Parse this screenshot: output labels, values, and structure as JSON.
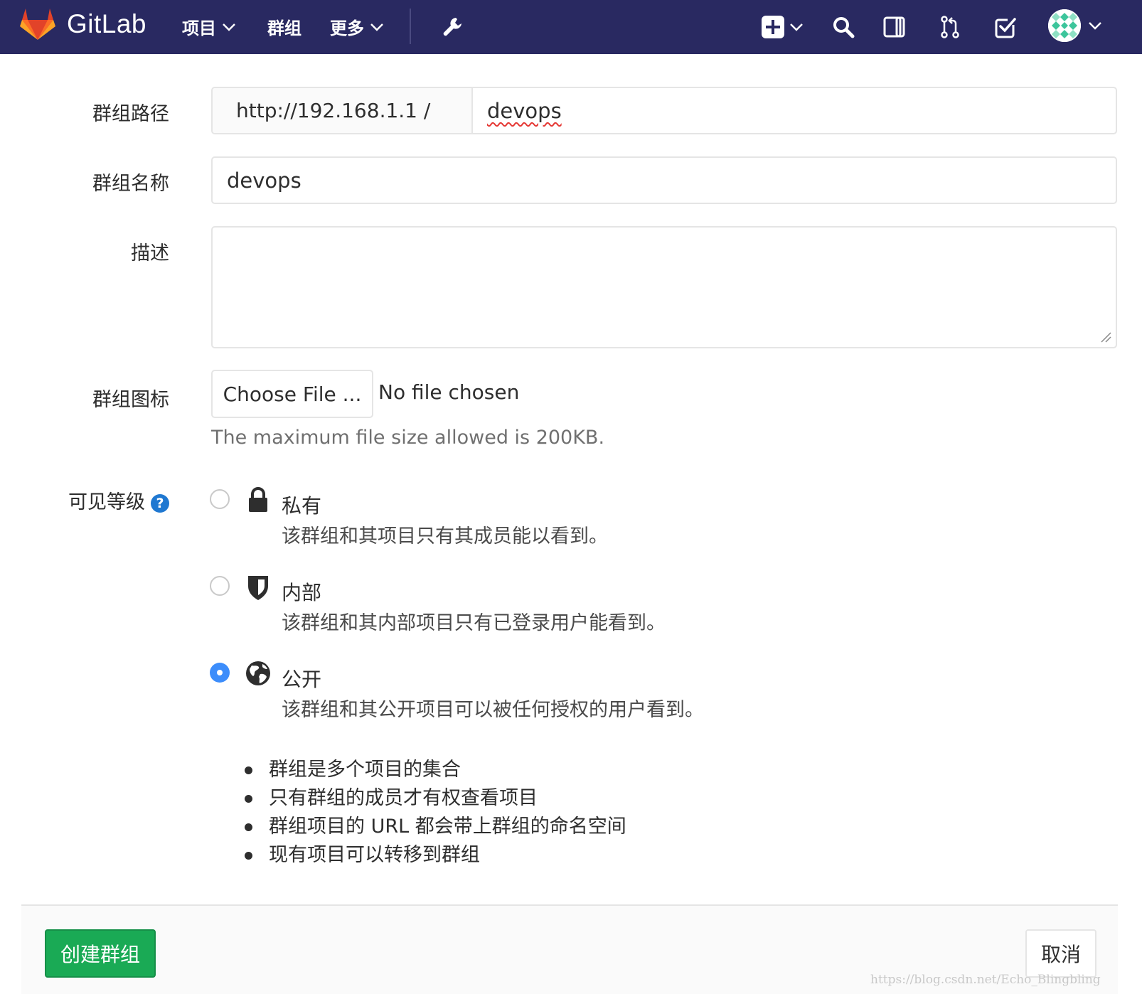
{
  "navbar": {
    "brand": "GitLab",
    "links": [
      {
        "label": "项目",
        "has_dropdown": true
      },
      {
        "label": "群组",
        "has_dropdown": false
      },
      {
        "label": "更多",
        "has_dropdown": true
      }
    ],
    "icons": [
      "wrench-icon",
      "plus-square-icon",
      "search-icon",
      "sidebar-panel-icon",
      "merge-request-icon",
      "todo-check-icon",
      "user-avatar"
    ]
  },
  "form": {
    "group_path": {
      "label": "群组路径",
      "prefix": "http://192.168.1.1 /",
      "value": "devops"
    },
    "group_name": {
      "label": "群组名称",
      "value": "devops"
    },
    "description": {
      "label": "描述",
      "value": ""
    },
    "group_avatar": {
      "label": "群组图标",
      "button": "Choose File ...",
      "status": "No file chosen",
      "help": "The maximum file size allowed is 200KB."
    },
    "visibility": {
      "label": "可见等级",
      "help_icon": "?",
      "options": [
        {
          "title": "私有",
          "description": "该群组和其项目只有其成员能以看到。",
          "icon": "lock-icon",
          "checked": false
        },
        {
          "title": "内部",
          "description": "该群组和其内部项目只有已登录用户能看到。",
          "icon": "shield-icon",
          "checked": false
        },
        {
          "title": "公开",
          "description": "该群组和其公开项目可以被任何授权的用户看到。",
          "icon": "globe-icon",
          "checked": true
        }
      ]
    },
    "info_bullets": [
      "群组是多个项目的集合",
      "只有群组的成员才有权查看项目",
      "群组项目的 URL 都会带上群组的命名空间",
      "现有项目可以转移到群组"
    ]
  },
  "actions": {
    "create": "创建群组",
    "cancel": "取消"
  },
  "watermark": "https://blog.csdn.net/Echo_Blingbling",
  "colors": {
    "navbar": "#292961",
    "create_button": "#1aaa55",
    "radio_checked": "#3c8dfb",
    "help_icon": "#1f78d1"
  }
}
